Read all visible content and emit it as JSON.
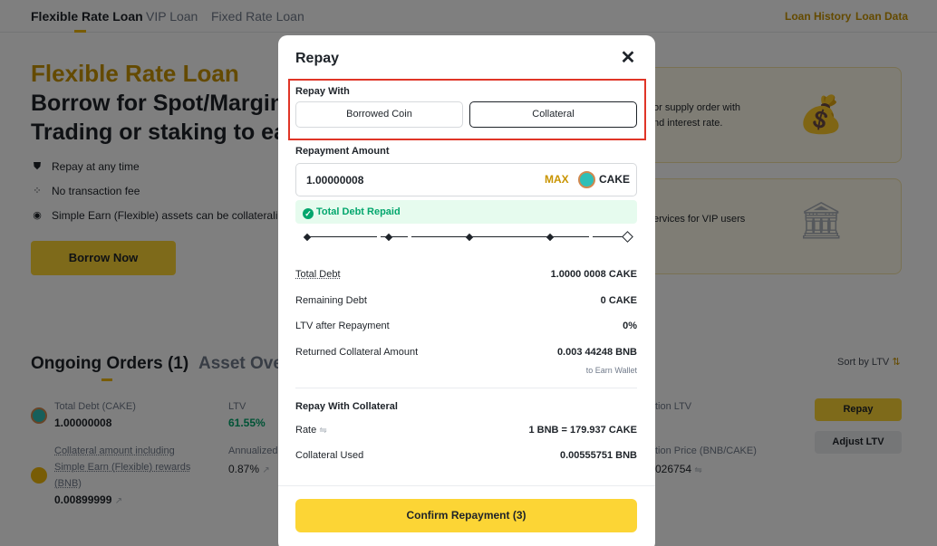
{
  "nav": {
    "tabs": [
      "Flexible Rate Loan",
      "VIP Loan",
      "Fixed Rate Loan"
    ],
    "links": [
      "Loan History",
      "Loan Data"
    ]
  },
  "hero": {
    "title": "Flexible Rate Loan",
    "subtitle_line1": "Borrow for Spot/Margin",
    "subtitle_line2": "Trading or staking to ea",
    "features": [
      {
        "icon": "shield-icon",
        "label": "Repay at any time"
      },
      {
        "icon": "grid-icon",
        "label": "No transaction fee"
      },
      {
        "icon": "target-icon",
        "label": "Simple Earn (Flexible) assets can be collateralized"
      }
    ],
    "borrow_button": "Borrow Now"
  },
  "cards": [
    {
      "line1": "or supply order with",
      "line2": "nd interest rate.",
      "icon": "money-bag-icon"
    },
    {
      "line1": "ervices for VIP users",
      "line2": "",
      "icon": "bank-icon"
    }
  ],
  "orders": {
    "title": "Ongoing Orders (1)",
    "asset_tab": "Asset Ove",
    "sort_label": "Sort by LTV",
    "total_debt_label": "Total Debt (CAKE)",
    "total_debt_value": "1.00000008",
    "ltv_label": "LTV",
    "ltv_value": "61.55%",
    "liq_ltv_label": "tion LTV",
    "collateral_label_1": "Collateral amount including",
    "collateral_label_2": "Simple Earn (Flexible) rewards",
    "collateral_label_3": "(BNB)",
    "collateral_value": "0.00899999",
    "annualized_label": "Annualized",
    "annualized_value": "0.87%",
    "liq_price_label": "tion Price (BNB/CAKE)",
    "liq_price_value": "026754",
    "repay_button": "Repay",
    "adjust_button": "Adjust LTV"
  },
  "modal": {
    "title": "Repay",
    "repay_with_label": "Repay With",
    "options": [
      "Borrowed Coin",
      "Collateral"
    ],
    "selected_option": "Collateral",
    "repayment_amount_label": "Repayment Amount",
    "amount_value": "1.00000008",
    "max_label": "MAX",
    "coin": "CAKE",
    "notice": "Total Debt Repaid",
    "slider_percent": 100,
    "rows": [
      {
        "label": "Total Debt",
        "value": "1.0000 0008 CAKE"
      },
      {
        "label": "Remaining Debt",
        "value": "0 CAKE"
      },
      {
        "label": "LTV after Repayment",
        "value": "0%"
      },
      {
        "label": "Returned Collateral Amount",
        "value": "0.003 44248 BNB",
        "sub": "to Earn Wallet"
      }
    ],
    "collateral_section_title": "Repay With Collateral",
    "rate_label": "Rate",
    "rate_value": "1 BNB = 179.937 CAKE",
    "collateral_used_label": "Collateral Used",
    "collateral_used_value": "0.00555751 BNB",
    "confirm_button": "Confirm Repayment (3)"
  },
  "colors": {
    "brand_yellow": "#fcd535",
    "brand_gold": "#c99400",
    "success_green": "#03a66d",
    "highlight_red": "#e03527"
  }
}
